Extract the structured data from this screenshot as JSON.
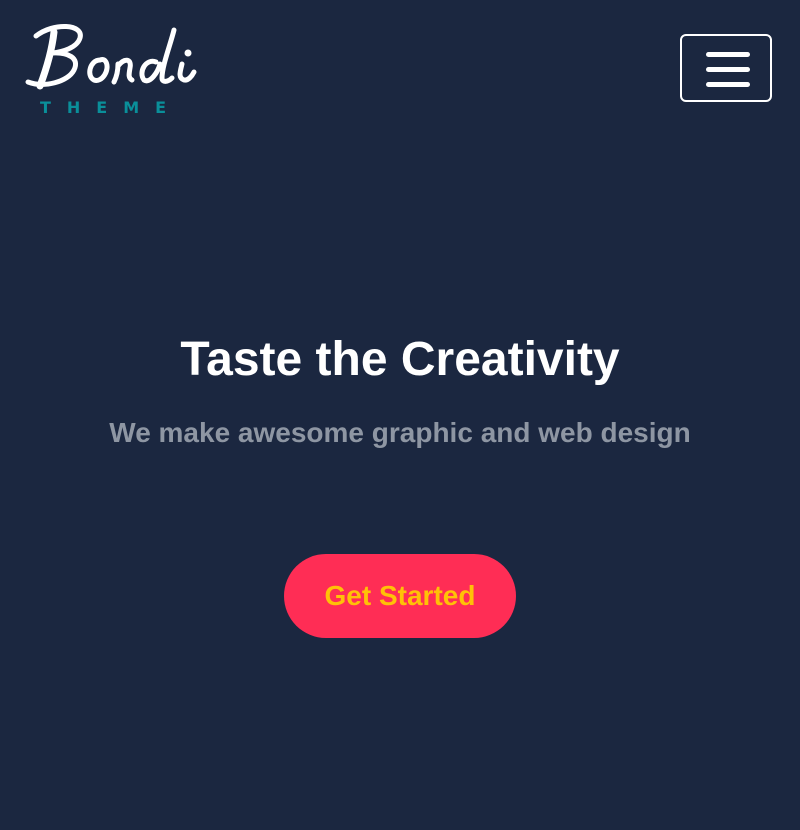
{
  "logo": {
    "name": "Bondi",
    "tagline": "THEME",
    "tagline_color": "#0a8f9a"
  },
  "header": {
    "menu_icon": "hamburger-menu-icon"
  },
  "hero": {
    "title": "Taste the Creativity",
    "subtitle": "We make awesome graphic and web design",
    "cta_label": "Get Started"
  },
  "colors": {
    "background": "#1b2740",
    "cta_background": "#ff2d55",
    "cta_text": "#ffc107",
    "subtitle_text": "#8e96a3"
  }
}
